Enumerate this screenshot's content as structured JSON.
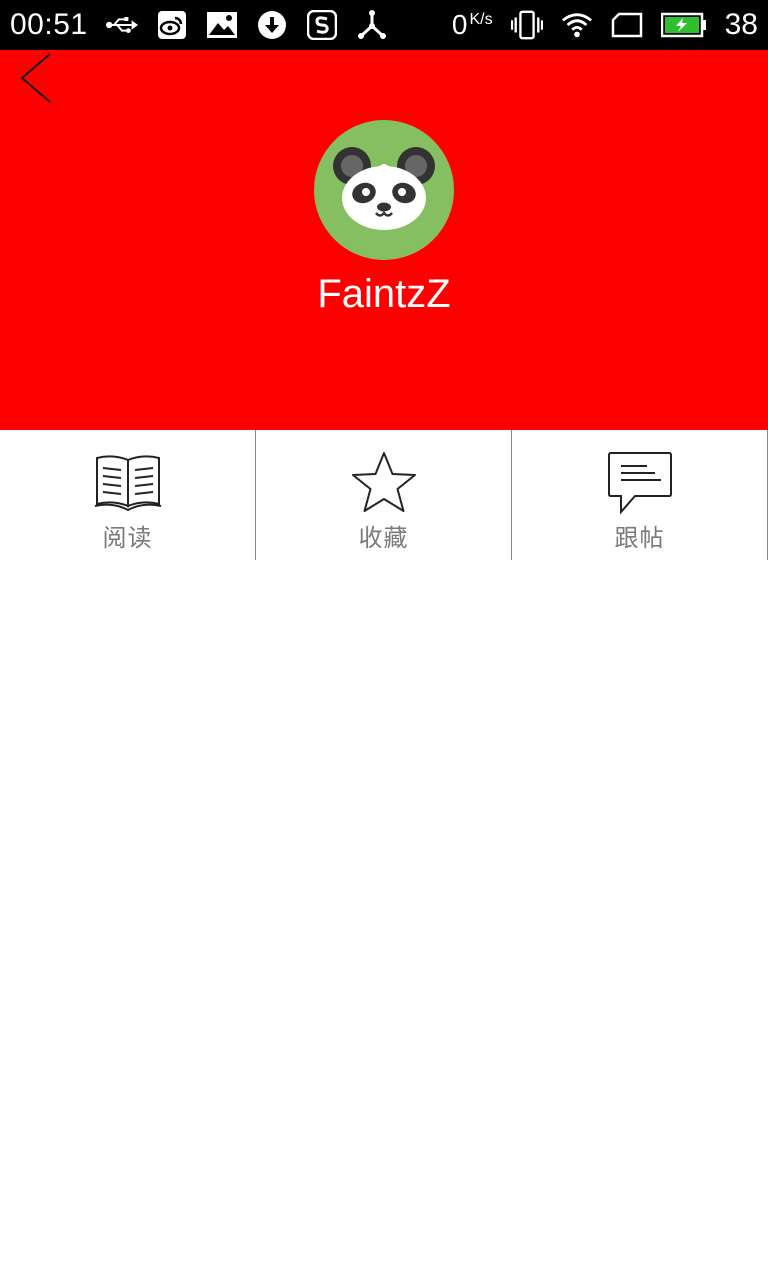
{
  "status_bar": {
    "time": "00:51",
    "left_icons": [
      "usb-icon",
      "weibo-icon",
      "image-icon",
      "download-icon",
      "sync-s-icon",
      "share-tripod-icon"
    ],
    "net_speed": "0",
    "net_speed_unit": "K/s",
    "right_icons": [
      "vibrate-icon",
      "wifi-icon",
      "sim-card-icon",
      "battery-charging-icon"
    ],
    "battery_level": "38",
    "battery_color": "#2fbf2f"
  },
  "header": {
    "background_color": "#ff0000",
    "back_icon": "chevron-left-icon",
    "avatar_icon": "panda-avatar",
    "avatar_bg": "#86bf62",
    "username": "FaintzZ"
  },
  "tabs": [
    {
      "label": "阅读",
      "icon": "book-icon"
    },
    {
      "label": "收藏",
      "icon": "star-icon"
    },
    {
      "label": "跟帖",
      "icon": "comment-icon"
    }
  ]
}
